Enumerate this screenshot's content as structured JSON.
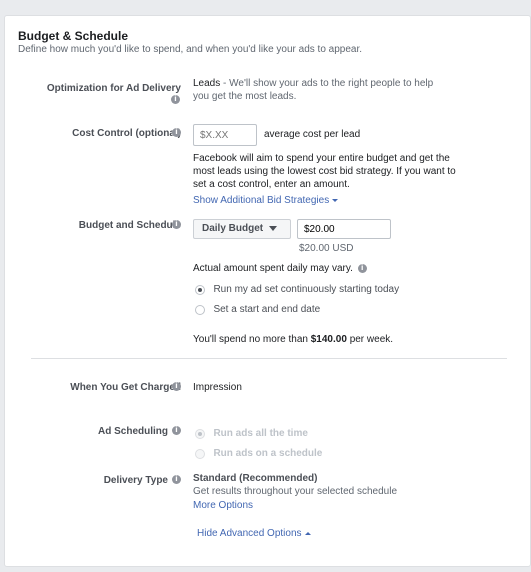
{
  "section": {
    "title": "Budget & Schedule",
    "subtitle": "Define how much you'd like to spend, and when you'd like your ads to appear."
  },
  "optimization": {
    "label": "Optimization for Ad Delivery",
    "value": "Leads",
    "description": "- We'll show your ads to the right people to help",
    "description_line2": "you get the most leads."
  },
  "cost_control": {
    "label": "Cost Control (optional)",
    "placeholder": "$X.XX",
    "suffix": "average cost per lead",
    "description_lines": [
      "Facebook will aim to spend your entire budget and get the",
      "most leads using the lowest cost bid strategy. If you want to",
      "set a cost control, enter an amount."
    ],
    "bid_link": "Show Additional Bid Strategies"
  },
  "budget": {
    "label": "Budget and Schedule",
    "type_selected": "Daily Budget",
    "amount": "$20.00",
    "amount_note": "$20.00 USD",
    "vary_note": "Actual amount spent daily may vary.",
    "options": [
      {
        "label": "Run my ad set continuously starting today",
        "checked": true
      },
      {
        "label": "Set a start and end date",
        "checked": false
      }
    ],
    "spend_prefix": "You'll spend no more than",
    "spend_amount": "$140.00",
    "spend_suffix": "per week."
  },
  "charged": {
    "label": "When You Get Charged",
    "value": "Impression"
  },
  "scheduling": {
    "label": "Ad Scheduling",
    "options": [
      {
        "label": "Run ads all the time",
        "checked": true
      },
      {
        "label": "Run ads on a schedule",
        "checked": false
      }
    ]
  },
  "delivery": {
    "label": "Delivery Type",
    "value": "Standard (Recommended)",
    "description": "Get results throughout your selected schedule",
    "more_link": "More Options"
  },
  "advanced_link": "Hide Advanced Options",
  "icons": {
    "info": "info-icon",
    "caret": "caret-down-icon"
  },
  "colors": {
    "link": "#4267b2",
    "label": "#4b4f56",
    "muted": "#606770",
    "background": "#e9ebee"
  }
}
